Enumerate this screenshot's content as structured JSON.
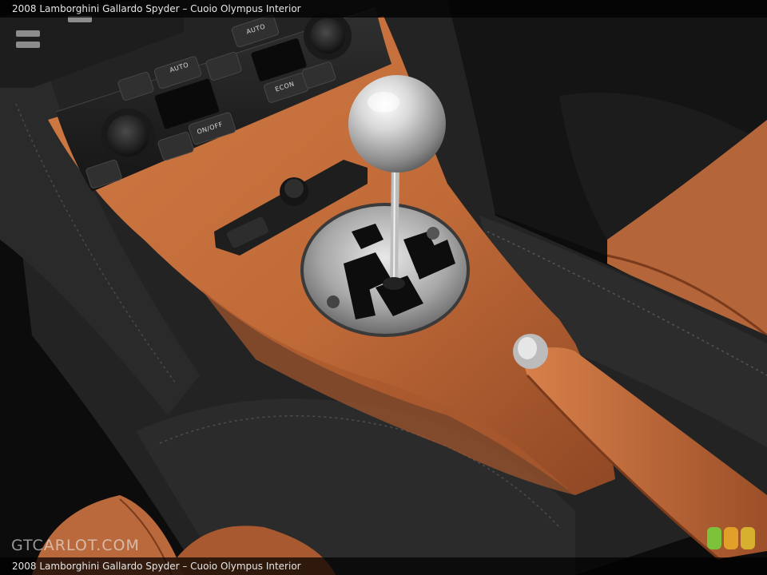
{
  "caption": {
    "top": "2008 Lamborghini Gallardo Spyder – Cuoio Olympus Interior",
    "bottom": "2008 Lamborghini Gallardo Spyder – Cuoio Olympus Interior"
  },
  "watermark": {
    "text": "GTCARLOT.COM"
  },
  "console_labels": {
    "auto_left": "AUTO",
    "auto_right": "AUTO",
    "on_off": "ON/OFF",
    "econ": "ECON"
  },
  "colors": {
    "leather": "#c2703e",
    "leather_dark": "#8a4624",
    "trim_dark": "#2a2a2a",
    "chrome": "#c9c9c9"
  },
  "badge": {
    "colors": [
      "#7cc23a",
      "#e0a02a",
      "#d8b030"
    ]
  }
}
